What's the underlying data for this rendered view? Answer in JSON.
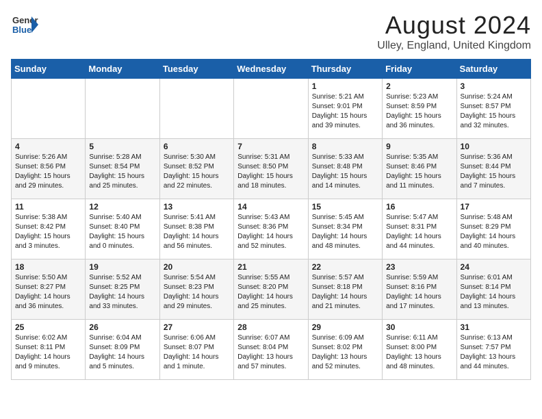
{
  "header": {
    "logo_general": "General",
    "logo_blue": "Blue",
    "month": "August 2024",
    "location": "Ulley, England, United Kingdom"
  },
  "weekdays": [
    "Sunday",
    "Monday",
    "Tuesday",
    "Wednesday",
    "Thursday",
    "Friday",
    "Saturday"
  ],
  "weeks": [
    [
      {
        "day": "",
        "content": ""
      },
      {
        "day": "",
        "content": ""
      },
      {
        "day": "",
        "content": ""
      },
      {
        "day": "",
        "content": ""
      },
      {
        "day": "1",
        "content": "Sunrise: 5:21 AM\nSunset: 9:01 PM\nDaylight: 15 hours\nand 39 minutes."
      },
      {
        "day": "2",
        "content": "Sunrise: 5:23 AM\nSunset: 8:59 PM\nDaylight: 15 hours\nand 36 minutes."
      },
      {
        "day": "3",
        "content": "Sunrise: 5:24 AM\nSunset: 8:57 PM\nDaylight: 15 hours\nand 32 minutes."
      }
    ],
    [
      {
        "day": "4",
        "content": "Sunrise: 5:26 AM\nSunset: 8:56 PM\nDaylight: 15 hours\nand 29 minutes."
      },
      {
        "day": "5",
        "content": "Sunrise: 5:28 AM\nSunset: 8:54 PM\nDaylight: 15 hours\nand 25 minutes."
      },
      {
        "day": "6",
        "content": "Sunrise: 5:30 AM\nSunset: 8:52 PM\nDaylight: 15 hours\nand 22 minutes."
      },
      {
        "day": "7",
        "content": "Sunrise: 5:31 AM\nSunset: 8:50 PM\nDaylight: 15 hours\nand 18 minutes."
      },
      {
        "day": "8",
        "content": "Sunrise: 5:33 AM\nSunset: 8:48 PM\nDaylight: 15 hours\nand 14 minutes."
      },
      {
        "day": "9",
        "content": "Sunrise: 5:35 AM\nSunset: 8:46 PM\nDaylight: 15 hours\nand 11 minutes."
      },
      {
        "day": "10",
        "content": "Sunrise: 5:36 AM\nSunset: 8:44 PM\nDaylight: 15 hours\nand 7 minutes."
      }
    ],
    [
      {
        "day": "11",
        "content": "Sunrise: 5:38 AM\nSunset: 8:42 PM\nDaylight: 15 hours\nand 3 minutes."
      },
      {
        "day": "12",
        "content": "Sunrise: 5:40 AM\nSunset: 8:40 PM\nDaylight: 15 hours\nand 0 minutes."
      },
      {
        "day": "13",
        "content": "Sunrise: 5:41 AM\nSunset: 8:38 PM\nDaylight: 14 hours\nand 56 minutes."
      },
      {
        "day": "14",
        "content": "Sunrise: 5:43 AM\nSunset: 8:36 PM\nDaylight: 14 hours\nand 52 minutes."
      },
      {
        "day": "15",
        "content": "Sunrise: 5:45 AM\nSunset: 8:34 PM\nDaylight: 14 hours\nand 48 minutes."
      },
      {
        "day": "16",
        "content": "Sunrise: 5:47 AM\nSunset: 8:31 PM\nDaylight: 14 hours\nand 44 minutes."
      },
      {
        "day": "17",
        "content": "Sunrise: 5:48 AM\nSunset: 8:29 PM\nDaylight: 14 hours\nand 40 minutes."
      }
    ],
    [
      {
        "day": "18",
        "content": "Sunrise: 5:50 AM\nSunset: 8:27 PM\nDaylight: 14 hours\nand 36 minutes."
      },
      {
        "day": "19",
        "content": "Sunrise: 5:52 AM\nSunset: 8:25 PM\nDaylight: 14 hours\nand 33 minutes."
      },
      {
        "day": "20",
        "content": "Sunrise: 5:54 AM\nSunset: 8:23 PM\nDaylight: 14 hours\nand 29 minutes."
      },
      {
        "day": "21",
        "content": "Sunrise: 5:55 AM\nSunset: 8:20 PM\nDaylight: 14 hours\nand 25 minutes."
      },
      {
        "day": "22",
        "content": "Sunrise: 5:57 AM\nSunset: 8:18 PM\nDaylight: 14 hours\nand 21 minutes."
      },
      {
        "day": "23",
        "content": "Sunrise: 5:59 AM\nSunset: 8:16 PM\nDaylight: 14 hours\nand 17 minutes."
      },
      {
        "day": "24",
        "content": "Sunrise: 6:01 AM\nSunset: 8:14 PM\nDaylight: 14 hours\nand 13 minutes."
      }
    ],
    [
      {
        "day": "25",
        "content": "Sunrise: 6:02 AM\nSunset: 8:11 PM\nDaylight: 14 hours\nand 9 minutes."
      },
      {
        "day": "26",
        "content": "Sunrise: 6:04 AM\nSunset: 8:09 PM\nDaylight: 14 hours\nand 5 minutes."
      },
      {
        "day": "27",
        "content": "Sunrise: 6:06 AM\nSunset: 8:07 PM\nDaylight: 14 hours\nand 1 minute."
      },
      {
        "day": "28",
        "content": "Sunrise: 6:07 AM\nSunset: 8:04 PM\nDaylight: 13 hours\nand 57 minutes."
      },
      {
        "day": "29",
        "content": "Sunrise: 6:09 AM\nSunset: 8:02 PM\nDaylight: 13 hours\nand 52 minutes."
      },
      {
        "day": "30",
        "content": "Sunrise: 6:11 AM\nSunset: 8:00 PM\nDaylight: 13 hours\nand 48 minutes."
      },
      {
        "day": "31",
        "content": "Sunrise: 6:13 AM\nSunset: 7:57 PM\nDaylight: 13 hours\nand 44 minutes."
      }
    ]
  ]
}
